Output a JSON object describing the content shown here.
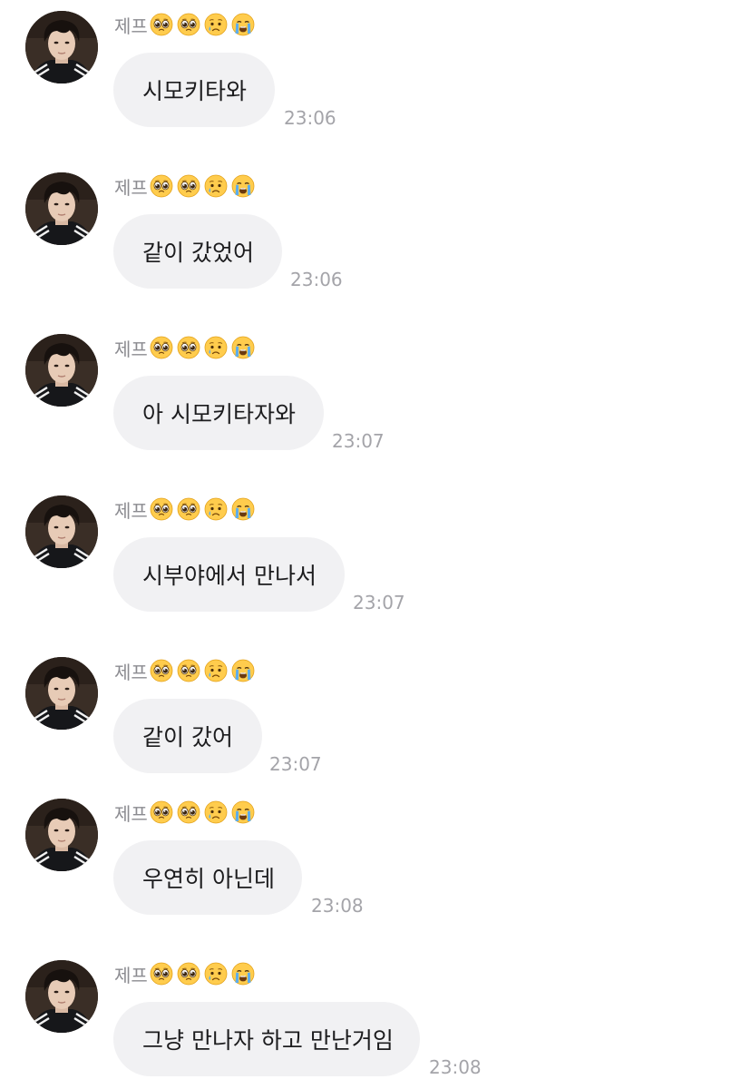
{
  "chat": {
    "sender_name": "제프",
    "sender_emojis": [
      "pleading-face-icon",
      "pleading-face-icon",
      "crying-face-icon",
      "loudly-crying-face-icon"
    ],
    "bubble_color": "#f1f1f3",
    "messages": [
      {
        "text": "시모키타와",
        "time": "23:06"
      },
      {
        "text": "같이 갔었어",
        "time": "23:06"
      },
      {
        "text": "아 시모키타자와",
        "time": "23:07"
      },
      {
        "text": "시부야에서 만나서",
        "time": "23:07"
      },
      {
        "text": "같이 갔어",
        "time": "23:07"
      },
      {
        "text": "우연히 아닌데",
        "time": "23:08"
      },
      {
        "text": "그냥 만나자 하고 만난거임",
        "time": "23:08"
      }
    ]
  }
}
